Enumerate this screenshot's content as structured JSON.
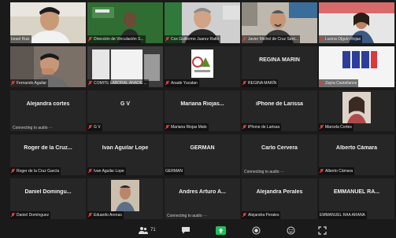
{
  "tiles": [
    {
      "label": "Israel Ruiz",
      "muted": false
    },
    {
      "label": "Dirección de Vinculación S...",
      "muted": true
    },
    {
      "label": "Cox Guillermo Juarez Ratto",
      "muted": true
    },
    {
      "label": "Javier Michel de Cruz Sánt...",
      "muted": true
    },
    {
      "label": "Lucina Olguín Rojas",
      "muted": true
    },
    {
      "label": "Fernando Aguilar",
      "muted": true
    },
    {
      "label": "COMITE LABORAL ANADE ...",
      "muted": true
    },
    {
      "label": "Anade Yucatan",
      "muted": true
    },
    {
      "name": "REGINA MARÍN",
      "label": "REGINA MARÍN",
      "muted": true
    },
    {
      "label": "Zayra Castellanos",
      "muted": true
    },
    {
      "name": "Alejandra cortes",
      "status": "Connecting to audio ···"
    },
    {
      "name": "G V",
      "label": "G V",
      "muted": true
    },
    {
      "name": "Mariana Riojas...",
      "label": "Mariana Riojas Malo",
      "muted": true
    },
    {
      "name": "iPhone de Larissa",
      "label": "iPhone de Larissa",
      "muted": true
    },
    {
      "label": "Marcela Cortes",
      "muted": true
    },
    {
      "name": "Roger de la Cruz...",
      "label": "Roger de la Cruz García",
      "muted": true
    },
    {
      "name": "Ivan Aguilar Lope",
      "label": "Ivan Aguilar Lope",
      "muted": true
    },
    {
      "name": "GERMAN",
      "label": "GERMAN",
      "muted": false
    },
    {
      "name": "Carlo Cervera",
      "status": "Connecting to audio ···"
    },
    {
      "name": "Alberto Cámara",
      "label": "Alberto Cámara",
      "muted": true
    },
    {
      "name": "Daniel Domingu...",
      "label": "Daniel Domínguez",
      "muted": true
    },
    {
      "label": "Eduardo Arenas",
      "muted": true
    },
    {
      "name": "Andres Arturo A...",
      "status": "Connecting to audio ···"
    },
    {
      "name": "Alejandra Perales",
      "label": "Alejandra Perales",
      "muted": true
    },
    {
      "name": "EMMANUEL RA...",
      "label": "EMMANUEL RAA ARANA",
      "muted": false
    }
  ],
  "toolbar": {
    "participants_count": "71",
    "icons": [
      "participants-icon",
      "chat-icon",
      "share-screen-icon",
      "record-icon",
      "reactions-icon",
      "fullscreen-icon"
    ],
    "share_color": "#1fbf5b"
  },
  "colors": {
    "active_speaker": "#d6e03a",
    "muted_mic": "#e23b3b"
  }
}
